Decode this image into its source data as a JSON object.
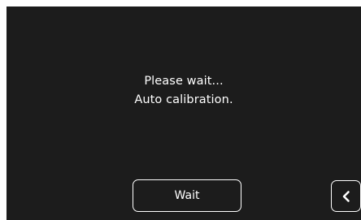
{
  "dialog": {
    "line1": "Please wait...",
    "line2": "Auto calibration."
  },
  "buttons": {
    "wait_label": "Wait",
    "back_icon": "chevron-left-icon"
  },
  "colors": {
    "screen_background": "#1c1c1c",
    "frame_background": "#ffffff",
    "foreground": "#ffffff"
  }
}
